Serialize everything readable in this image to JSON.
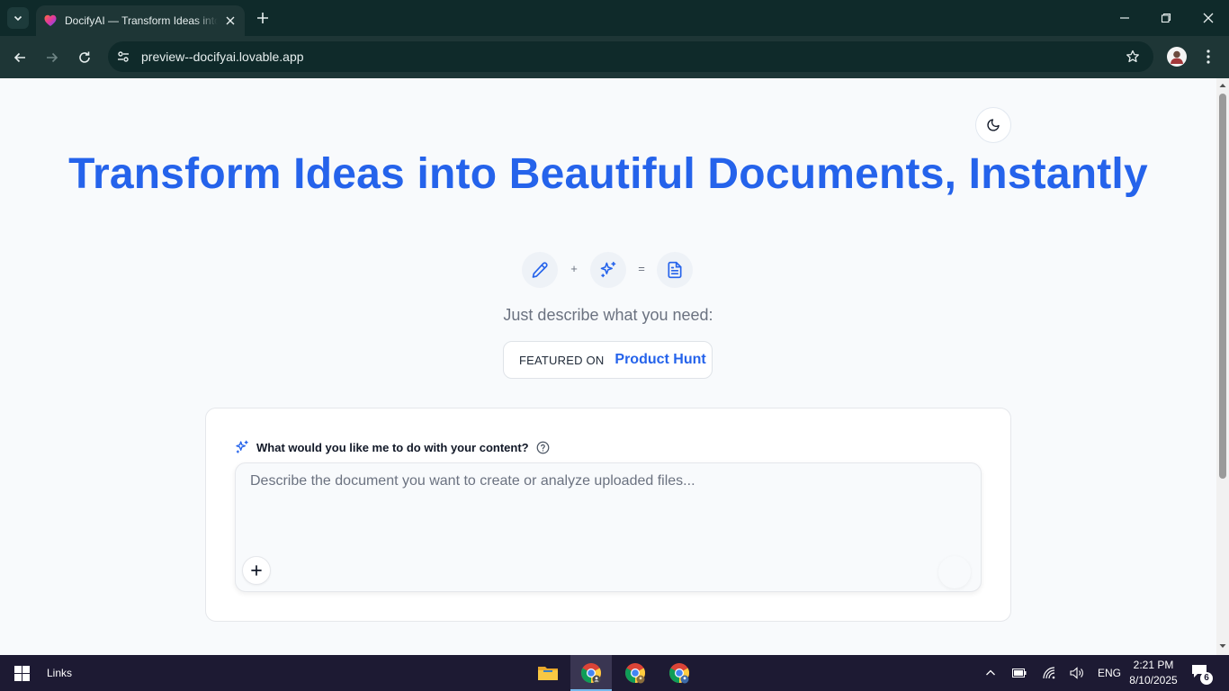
{
  "browser": {
    "tab_title": "DocifyAI — Transform Ideas into Beautiful Documents, Instantly",
    "url": "preview--docifyai.lovable.app"
  },
  "page": {
    "title": "Transform Ideas into Beautiful Documents, Instantly",
    "formula": {
      "plus": "+",
      "equals": "="
    },
    "subtitle": "Just describe what you need:",
    "product_hunt": {
      "featured": "FEATURED ON",
      "name": "Product Hunt"
    },
    "prompt": {
      "label": "What would you like me to do with your content?",
      "placeholder": "Describe the document you want to create or analyze uploaded files...",
      "value": ""
    }
  },
  "taskbar": {
    "links_label": "Links",
    "language": "ENG",
    "time": "2:21 PM",
    "date": "8/10/2025",
    "notification_count": "6"
  },
  "colors": {
    "accent": "#2563eb",
    "browser_frame": "#0f2a2a",
    "browser_toolbar": "#1e3636",
    "taskbar": "#1d1a33"
  }
}
